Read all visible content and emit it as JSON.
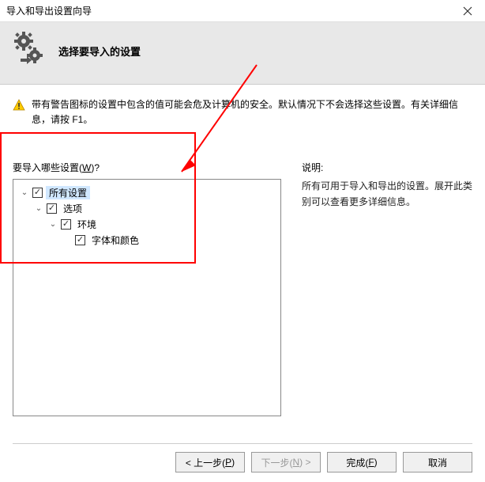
{
  "window": {
    "title": "导入和导出设置向导"
  },
  "header": {
    "title": "选择要导入的设置"
  },
  "warning": {
    "text": "带有警告图标的设置中包含的值可能会危及计算机的安全。默认情况下不会选择这些设置。有关详细信息，请按 F1。"
  },
  "prompt": {
    "prefix": "要导入哪些设置(",
    "mnemonic": "W",
    "suffix": ")?"
  },
  "tree": [
    {
      "indent": 4,
      "expanded": true,
      "checked": true,
      "label": "所有设置",
      "selected": true
    },
    {
      "indent": 22,
      "expanded": true,
      "checked": true,
      "label": "选项",
      "selected": false
    },
    {
      "indent": 40,
      "expanded": true,
      "checked": true,
      "label": "环境",
      "selected": false
    },
    {
      "indent": 58,
      "expanded": null,
      "checked": true,
      "label": "字体和颜色",
      "selected": false
    }
  ],
  "description": {
    "title": "说明:",
    "body": "所有可用于导入和导出的设置。展开此类别可以查看更多详细信息。"
  },
  "buttons": {
    "prev": {
      "prefix": "< 上一步(",
      "mnemonic": "P",
      "suffix": ")"
    },
    "next": {
      "prefix": "下一步(",
      "mnemonic": "N",
      "suffix": ") >"
    },
    "finish": {
      "prefix": "完成(",
      "mnemonic": "F",
      "suffix": ")"
    },
    "cancel": {
      "label": "取消"
    }
  }
}
